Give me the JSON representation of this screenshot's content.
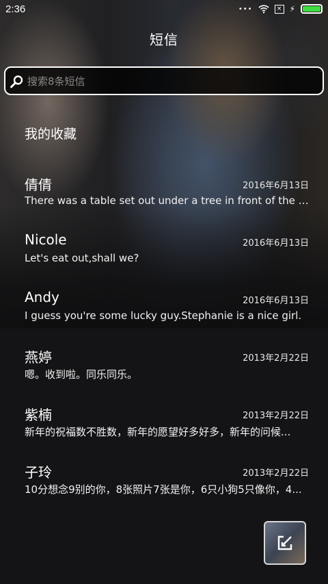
{
  "status_bar": {
    "time": "2:36",
    "battery_level": 1.0,
    "battery_color": "#3fdc3f",
    "icons": [
      "signal-dots-icon",
      "wifi-icon",
      "sim-icon",
      "charging-icon",
      "battery-icon"
    ]
  },
  "header": {
    "title": "短信"
  },
  "search": {
    "placeholder": "搜索8条短信",
    "value": ""
  },
  "favorites": {
    "label": "我的收藏"
  },
  "conversations": [
    {
      "name": "倩倩",
      "date": "2016年6月13日",
      "preview": "There was a table set out under a tree in front of the ho..."
    },
    {
      "name": "Nicole",
      "date": "2016年6月13日",
      "preview": "Let's eat out,shall we?"
    },
    {
      "name": "Andy",
      "date": "2016年6月13日",
      "preview": "I guess you're some lucky guy.Stephanie is a nice girl."
    },
    {
      "name": "燕婷",
      "date": "2013年2月22日",
      "preview": "嗯。收到啦。同乐同乐。"
    },
    {
      "name": "紫楠",
      "date": "2013年2月22日",
      "preview": "新年的祝福数不胜数，新年的愿望好多好多，新年的问候..."
    },
    {
      "name": "子玲",
      "date": "2013年2月22日",
      "preview": "10分想念9别的你，8张照片7张是你，6只小狗5只像你，4..."
    }
  ],
  "compose": {
    "icon": "compose-icon"
  }
}
